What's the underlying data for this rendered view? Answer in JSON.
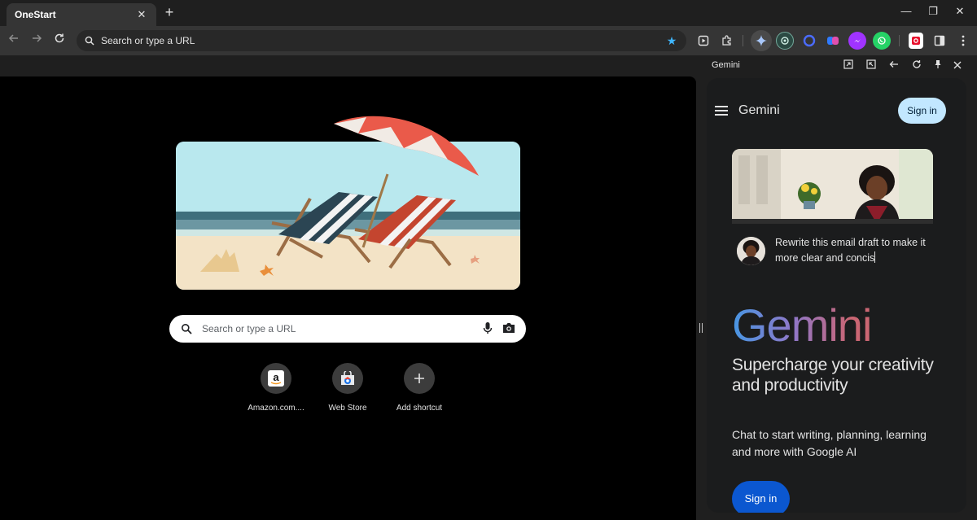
{
  "browser": {
    "tab": {
      "title": "OneStart",
      "close_glyph": "✕"
    },
    "new_tab_glyph": "+",
    "window_controls": {
      "minimize": "—",
      "restore": "❐",
      "close": "✕"
    },
    "omnibox": {
      "placeholder": "Search or type a URL"
    }
  },
  "extensions": [
    {
      "name": "media-icon",
      "color": "#e3e3e3"
    },
    {
      "name": "puzzle-extensions-icon",
      "color": "#e3e3e3"
    },
    {
      "name": "gemini-spark-icon",
      "color": "#a8c7fa"
    },
    {
      "name": "chatgpt-icon",
      "color": "#74aa9c"
    },
    {
      "name": "opera-ring-icon",
      "color": "#4b6cff"
    },
    {
      "name": "copilot-icon",
      "color": "#7b61ff"
    },
    {
      "name": "messenger-icon",
      "color": "#a033ff"
    },
    {
      "name": "whatsapp-icon",
      "color": "#25d366"
    },
    {
      "name": "onestart-badge-icon",
      "color": "#e8112d"
    },
    {
      "name": "side-panel-icon",
      "color": "#e3e3e3"
    }
  ],
  "side_panel": {
    "title": "Gemini"
  },
  "ntp": {
    "search": {
      "placeholder": "Search or type a URL"
    },
    "shortcuts": [
      {
        "label": "Amazon.com....",
        "icon": "amazon-icon"
      },
      {
        "label": "Web Store",
        "icon": "web-store-icon"
      },
      {
        "label": "Add shortcut",
        "icon": "plus-icon"
      }
    ]
  },
  "gemini": {
    "brand": "Gemini",
    "sign_in_top": "Sign in",
    "prompt_text": "Rewrite this email draft to make it more clear and concis",
    "logo": "Gemini",
    "headline": "Supercharge your creativity and productivity",
    "subtext": "Chat to start writing, planning, learning and more with Google AI",
    "sign_in_bottom": "Sign in"
  }
}
